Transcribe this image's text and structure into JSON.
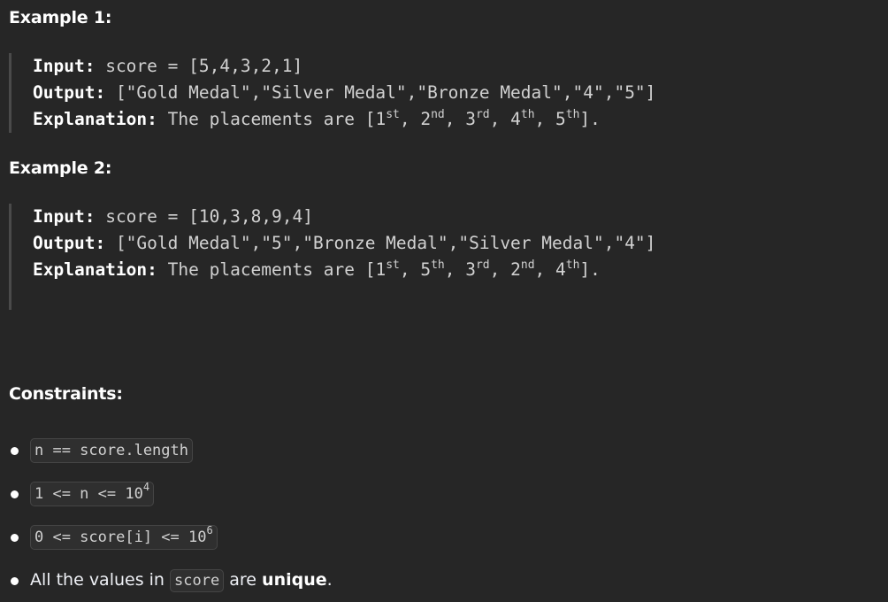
{
  "example1": {
    "heading": "Example 1:",
    "input_label": "Input:",
    "input_value": "score = [5,4,3,2,1]",
    "output_label": "Output:",
    "output_value": "[\"Gold Medal\",\"Silver Medal\",\"Bronze Medal\",\"4\",\"5\"]",
    "explanation_label": "Explanation:",
    "explanation_prefix": "The placements are [",
    "placements": [
      {
        "num": "1",
        "sup": "st"
      },
      {
        "num": "2",
        "sup": "nd"
      },
      {
        "num": "3",
        "sup": "rd"
      },
      {
        "num": "4",
        "sup": "th"
      },
      {
        "num": "5",
        "sup": "th"
      }
    ],
    "explanation_suffix": "]."
  },
  "example2": {
    "heading": "Example 2:",
    "input_label": "Input:",
    "input_value": "score = [10,3,8,9,4]",
    "output_label": "Output:",
    "output_value": "[\"Gold Medal\",\"5\",\"Bronze Medal\",\"Silver Medal\",\"4\"]",
    "explanation_label": "Explanation:",
    "explanation_prefix": "The placements are [",
    "placements": [
      {
        "num": "1",
        "sup": "st"
      },
      {
        "num": "5",
        "sup": "th"
      },
      {
        "num": "3",
        "sup": "rd"
      },
      {
        "num": "2",
        "sup": "nd"
      },
      {
        "num": "4",
        "sup": "th"
      }
    ],
    "explanation_suffix": "]."
  },
  "constraints": {
    "heading": "Constraints:",
    "c1_code": "n == score.length",
    "c2_code": "1 <= n <= 10",
    "c2_sup": "4",
    "c3_code": "0 <= score[i] <= 10",
    "c3_sup": "6",
    "c4_prefix": "All the values in",
    "c4_code": "score",
    "c4_middle": "are",
    "c4_bold": "unique",
    "c4_suffix": "."
  }
}
